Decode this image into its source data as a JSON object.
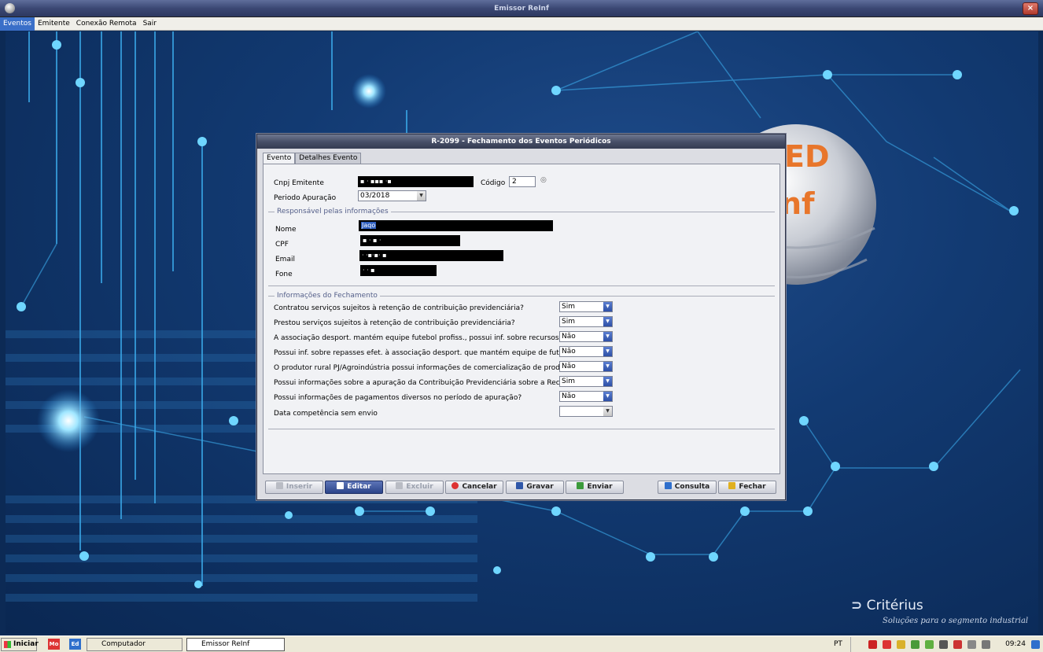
{
  "window": {
    "title": "Emissor ReInf",
    "close_label": "×"
  },
  "menu": {
    "items": [
      "Eventos",
      "Emitente",
      "Conexão Remota",
      "Sair"
    ],
    "active": "Eventos"
  },
  "brand": {
    "logo_partial_1": "ED",
    "logo_partial_2": "nf",
    "company": "Critérius",
    "tagline": "Soluções para o segmento industrial"
  },
  "dialog": {
    "title": "R-2099 - Fechamento dos Eventos Periódicos",
    "tabs": [
      "Evento",
      "Detalhes Evento"
    ],
    "active_tab": "Evento",
    "header": {
      "cnpj_label": "Cnpj Emitente",
      "cnpj_value": "▪  ·  ▪▪▪ ·▪",
      "codigo_label": "Código",
      "codigo_value": "2",
      "periodo_label": "Periodo Apuração",
      "periodo_value": "03/2018"
    },
    "responsavel": {
      "group_title": "Responsável pelas informações",
      "nome_label": "Nome",
      "nome_value": "Jaqo",
      "cpf_label": "CPF",
      "cpf_value": "▪  ·  ▪ ·",
      "email_label": "Email",
      "email_value": "· ·▪·▪· ▪",
      "fone_label": "Fone",
      "fone_value": "·  · ▪"
    },
    "fechamento": {
      "group_title": "Informações do Fechamento",
      "questions": [
        {
          "label": "Contratou serviços sujeitos à retenção de contribuição previdenciária?",
          "value": "Sim"
        },
        {
          "label": "Prestou serviços sujeitos à retenção de contribuição previdenciária?",
          "value": "Sim"
        },
        {
          "label": "A associação desport. mantém equipe futebol profiss., possui inf. sobre recursos recebidos?",
          "value": "Não"
        },
        {
          "label": "Possui inf. sobre repasses efet. à associação desport. que mantém equipe de futebol profiss.?",
          "value": "Não"
        },
        {
          "label": "O produtor rural PJ/Agroindústria possui informações de comercialização de produção?",
          "value": "Não"
        },
        {
          "label": "Possui informações sobre a apuração da Contribuição Previdenciária sobre a Receita Bruta?",
          "value": "Sim"
        },
        {
          "label": "Possui informações de pagamentos diversos no período de apuração?",
          "value": "Não"
        }
      ],
      "data_competencia_label": "Data competência sem envio",
      "data_competencia_value": ""
    },
    "buttons": {
      "inserir": "Inserir",
      "editar": "Editar",
      "excluir": "Excluir",
      "cancelar": "Cancelar",
      "gravar": "Gravar",
      "enviar": "Enviar",
      "consulta": "Consulta",
      "fechar": "Fechar"
    }
  },
  "taskbar": {
    "start": "Iniciar",
    "quick_icons": [
      "Mo",
      "Ed"
    ],
    "tasks": [
      {
        "label": "Computador",
        "active": false
      },
      {
        "label": "Emissor ReInf",
        "active": true
      }
    ],
    "lang": "PT",
    "clock": "09:24"
  },
  "colors": {
    "accent": "#3a6fc8",
    "primary_button": "#2b4489",
    "desktop": "#123a72",
    "logo_orange": "#e8762b"
  }
}
